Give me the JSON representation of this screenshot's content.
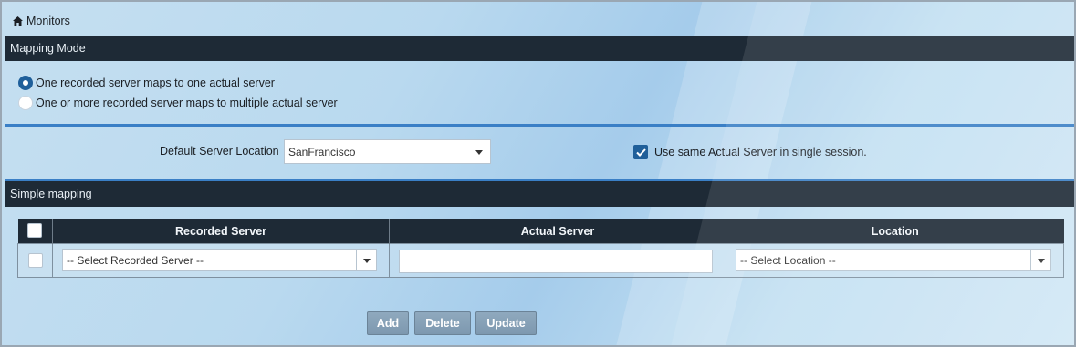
{
  "breadcrumb": {
    "icon": "home-icon",
    "label": "Monitors"
  },
  "mapping_mode": {
    "title": "Mapping Mode",
    "options": [
      {
        "label": "One recorded server maps to one actual server",
        "checked": true
      },
      {
        "label": "One or more recorded server maps to multiple actual server",
        "checked": false
      }
    ]
  },
  "location": {
    "label": "Default Server Location",
    "value": "SanFrancisco",
    "same_session_label": "Use same Actual Server in single session.",
    "same_session_checked": true
  },
  "simple_mapping": {
    "title": "Simple mapping",
    "columns": [
      "Recorded Server",
      "Actual Server",
      "Location"
    ],
    "row": {
      "recorded_placeholder": "-- Select Recorded Server --",
      "actual_value": "",
      "location_placeholder": "-- Select Location --"
    }
  },
  "buttons": {
    "add": "Add",
    "delete": "Delete",
    "update": "Update"
  },
  "colors": {
    "header_bg": "#1e2a36",
    "accent": "#1f5f9a",
    "rule": "#3a7fc6"
  }
}
